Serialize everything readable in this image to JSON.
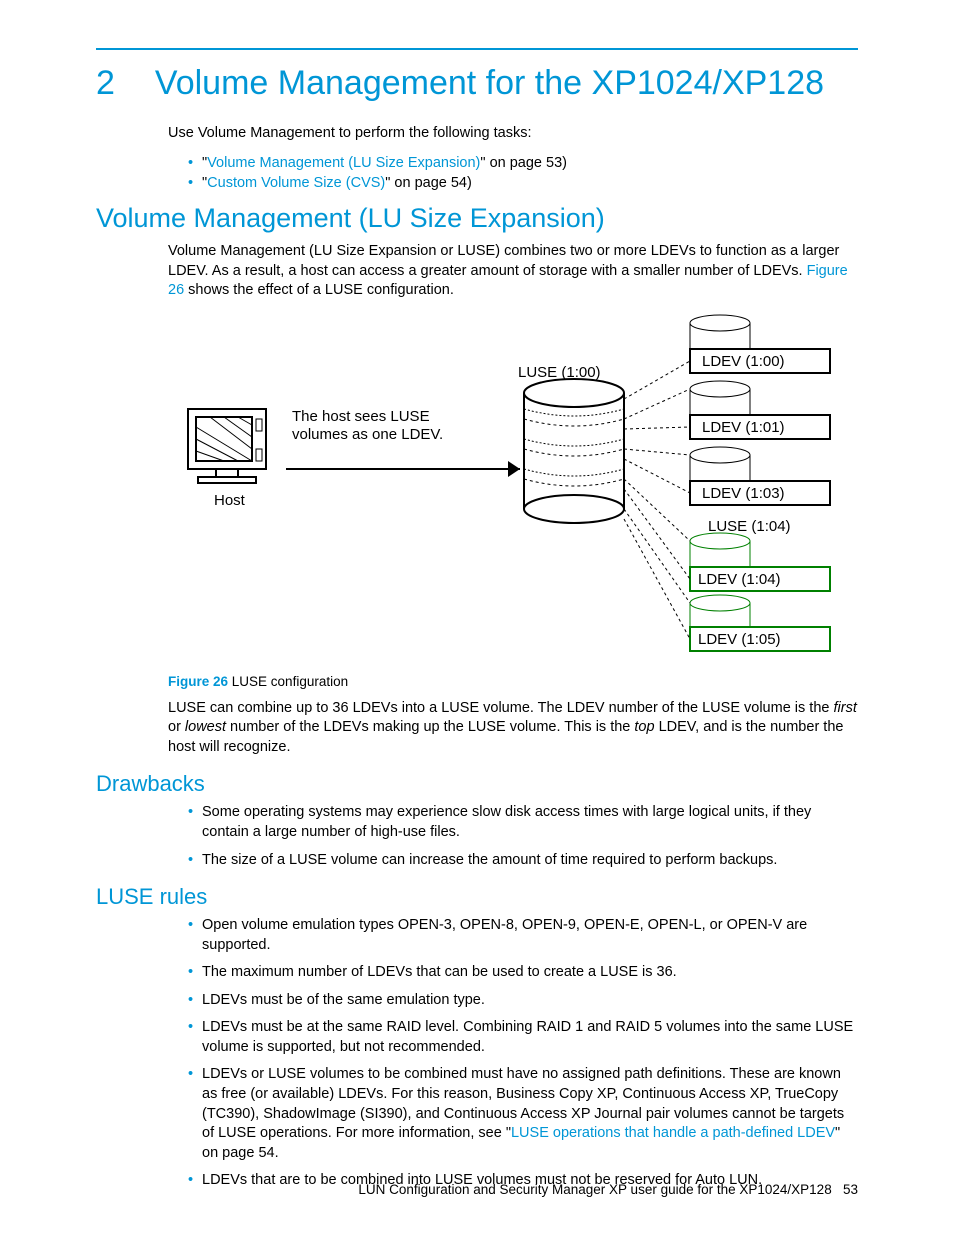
{
  "chapter": {
    "num": "2",
    "title": "Volume Management for the XP1024/XP128"
  },
  "intro": "Use Volume Management to perform the following tasks:",
  "toc": {
    "item1_pre": "\"",
    "item1_link": "Volume Management (LU Size Expansion)",
    "item1_post": "\" on page 53)",
    "item2_pre": "\"",
    "item2_link": "Custom Volume Size (CVS)",
    "item2_post": "\" on page 54)"
  },
  "sec1": {
    "heading": "Volume Management (LU Size Expansion)",
    "p1a": "Volume Management (LU Size Expansion or LUSE) combines two or more LDEVs to function as a larger LDEV. As a result, a host can access a greater amount of storage with a smaller number of LDEVs. ",
    "p1_link": "Figure 26",
    "p1b": " shows the effect of a LUSE configuration."
  },
  "diagram": {
    "host_label": "Host",
    "host_caption": "The host sees LUSE\nvolumes as one LDEV.",
    "luse_top": "LUSE (1:00)",
    "ldev_100": "LDEV (1:00)",
    "ldev_101": "LDEV (1:01)",
    "ldev_103": "LDEV (1:03)",
    "luse_104": "LUSE (1:04)",
    "ldev_104": "LDEV (1:04)",
    "ldev_105": "LDEV (1:05)"
  },
  "fig": {
    "num": "Figure 26",
    "caption": " LUSE configuration"
  },
  "p2a": "LUSE can combine up to 36 LDEVs into a LUSE volume. The LDEV number of the LUSE volume is the ",
  "p2_em1": "first",
  "p2b": " or ",
  "p2_em2": "lowest",
  "p2c": " number of the LDEVs making up the LUSE volume. This is the ",
  "p2_em3": "top",
  "p2d": " LDEV, and is the number the host will recognize.",
  "drawbacks": {
    "heading": "Drawbacks",
    "b1": "Some operating systems may experience slow disk access times with large logical units, if they contain a large number of high-use files.",
    "b2": "The size of a LUSE volume can increase the amount of time required to perform backups."
  },
  "rules": {
    "heading": "LUSE rules",
    "r1": "Open volume emulation types OPEN-3, OPEN-8, OPEN-9, OPEN-E, OPEN-L, or OPEN-V are supported.",
    "r2": "The maximum number of LDEVs that can be used to create a LUSE is 36.",
    "r3": "LDEVs must be of the same emulation type.",
    "r4": "LDEVs must be at the same RAID level. Combining RAID 1 and RAID 5 volumes into the same LUSE volume is supported, but not recommended.",
    "r5a": "LDEVs or LUSE volumes to be combined must have no assigned path definitions. These are known as free (or available) LDEVs. For this reason, Business Copy XP, Continuous Access XP, TrueCopy (TC390), ShadowImage (SI390), and Continuous Access XP Journal pair volumes cannot be targets of LUSE operations. For more information, see \"",
    "r5_link": "LUSE operations that handle a path-defined LDEV",
    "r5b": "\" on page 54.",
    "r6": "LDEVs that are to be combined into LUSE volumes must not be reserved for Auto LUN."
  },
  "footer": {
    "title": "LUN Configuration and Security Manager XP user guide for the XP1024/XP128",
    "page": "53"
  }
}
